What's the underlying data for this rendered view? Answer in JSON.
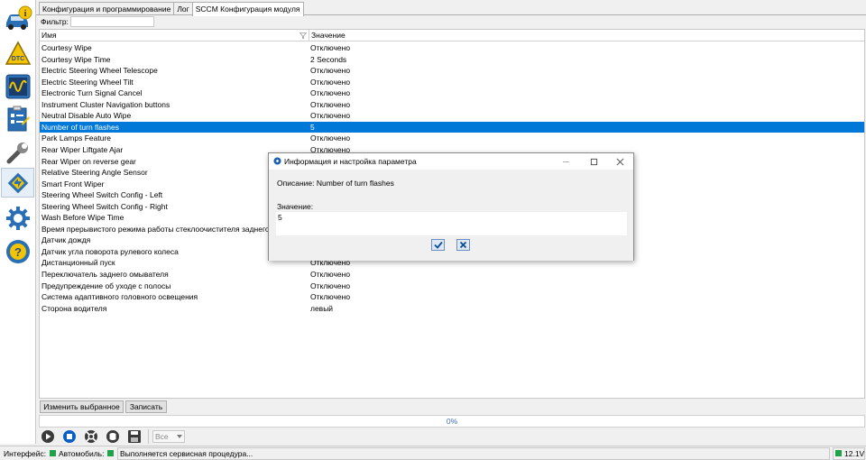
{
  "tabs": [
    {
      "label": "Конфигурация и программирование"
    },
    {
      "label": "Лог"
    },
    {
      "label": "SCCM Конфигурация модуля"
    }
  ],
  "filter": {
    "label": "Фильтр:",
    "value": ""
  },
  "grid": {
    "columns": {
      "name": "Имя",
      "value": "Значение"
    },
    "rows": [
      {
        "name": "Courtesy Wipe",
        "value": "Отключено"
      },
      {
        "name": "Courtesy Wipe Time",
        "value": "2 Seconds"
      },
      {
        "name": "Electric Steering Wheel Telescope",
        "value": "Отключено"
      },
      {
        "name": "Electric Steering Wheel Tilt",
        "value": "Отключено"
      },
      {
        "name": "Electronic Turn Signal Cancel",
        "value": "Отключено"
      },
      {
        "name": "Instrument Cluster Navigation buttons",
        "value": "Отключено"
      },
      {
        "name": "Neutral Disable Auto Wipe",
        "value": "Отключено"
      },
      {
        "name": "Number of turn flashes",
        "value": "5",
        "selected": true
      },
      {
        "name": "Park Lamps Feature",
        "value": "Отключено"
      },
      {
        "name": "Rear Wiper Liftgate Ajar",
        "value": "Отключено"
      },
      {
        "name": "Rear Wiper on reverse gear",
        "value": ""
      },
      {
        "name": "Relative Steering Angle Sensor",
        "value": ""
      },
      {
        "name": "Smart Front Wiper",
        "value": ""
      },
      {
        "name": "Steering Wheel Switch Config - Left",
        "value": ""
      },
      {
        "name": "Steering Wheel Switch Config - Right",
        "value": ""
      },
      {
        "name": "Wash Before Wipe Time",
        "value": ""
      },
      {
        "name": "Время прерывистого режима работы стеклоочистителя заднего",
        "value": ""
      },
      {
        "name": "Датчик дождя",
        "value": ""
      },
      {
        "name": "Датчик угла поворота рулевого колеса",
        "value": ""
      },
      {
        "name": "Дистанционный пуск",
        "value": "Отключено"
      },
      {
        "name": "Переключатель заднего омывателя",
        "value": "Отключено"
      },
      {
        "name": "Предупреждение об уходе с полосы",
        "value": "Отключено"
      },
      {
        "name": "Система адаптивного головного освещения",
        "value": "Отключено"
      },
      {
        "name": "Сторона водителя",
        "value": "левый"
      }
    ]
  },
  "buttons": {
    "edit_selected": "Изменить выбранное",
    "write": "Записать"
  },
  "progress": {
    "text": "0%"
  },
  "toolbar": {
    "filter_select": "Все"
  },
  "statusbar": {
    "interface_label": "Интерфейс:",
    "vehicle_label": "Автомобиль:",
    "status_text": "Выполняется сервисная процедура...",
    "voltage": "12.1V"
  },
  "dialog": {
    "title": "Информация и настройка параметра",
    "description": "Описание: Number of turn flashes",
    "value_label": "Значение:",
    "value": "5"
  },
  "sidebar_icons": [
    "vehicle-info-icon",
    "dtc-icon",
    "oscilloscope-icon",
    "checklist-icon",
    "wrench-icon",
    "module-config-icon",
    "gear-icon",
    "help-icon"
  ],
  "colors": {
    "selection": "#0078d7",
    "status_led": "#1ea34a",
    "progress_text": "#3b6fb6"
  }
}
